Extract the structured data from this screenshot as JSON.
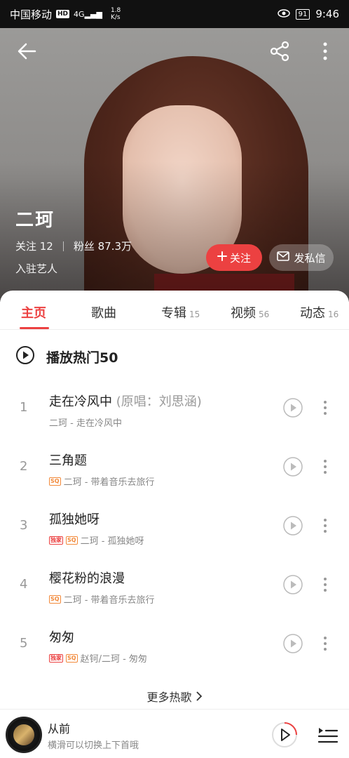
{
  "status_bar": {
    "carrier": "中国移动",
    "hd": "HD",
    "network": "4G",
    "speed_value": "1.8",
    "speed_unit": "K/s",
    "battery": "91",
    "time": "9:46"
  },
  "artist": {
    "name": "二珂",
    "following_label": "关注 12",
    "fans_label": "粉丝 87.3万",
    "tag": "入驻艺人"
  },
  "actions": {
    "follow": "关注",
    "message": "发私信"
  },
  "tabs": [
    {
      "label": "主页",
      "count": ""
    },
    {
      "label": "歌曲",
      "count": ""
    },
    {
      "label": "专辑",
      "count": "15"
    },
    {
      "label": "视频",
      "count": "56"
    },
    {
      "label": "动态",
      "count": "16"
    }
  ],
  "hot_section": {
    "title": "播放热门50",
    "more_label": "更多热歌"
  },
  "songs": [
    {
      "index": "1",
      "title": "走在冷风中",
      "original": "(原唱：刘思涵)",
      "badges": [],
      "subtitle": "二珂 - 走在冷风中"
    },
    {
      "index": "2",
      "title": "三角题",
      "original": "",
      "badges": [
        "SQ"
      ],
      "subtitle": "二珂 - 带着音乐去旅行"
    },
    {
      "index": "3",
      "title": "孤独她呀",
      "original": "",
      "badges": [
        "独家",
        "SQ"
      ],
      "subtitle": "二珂 - 孤独她呀"
    },
    {
      "index": "4",
      "title": "樱花粉的浪漫",
      "original": "",
      "badges": [
        "SQ"
      ],
      "subtitle": "二珂 - 带着音乐去旅行"
    },
    {
      "index": "5",
      "title": "匆匆",
      "original": "",
      "badges": [
        "独家",
        "SQ"
      ],
      "subtitle": "赵钶/二珂 - 匆匆"
    }
  ],
  "player": {
    "title": "从前",
    "subtitle": "横滑可以切换上下首哦"
  },
  "colors": {
    "accent": "#ec4141",
    "sq_badge": "#f28a3b"
  },
  "icons": [
    "back-arrow-icon",
    "share-icon",
    "more-vertical-icon",
    "plus-icon",
    "mail-icon",
    "play-circle-icon",
    "play-small-icon",
    "playlist-icon"
  ]
}
